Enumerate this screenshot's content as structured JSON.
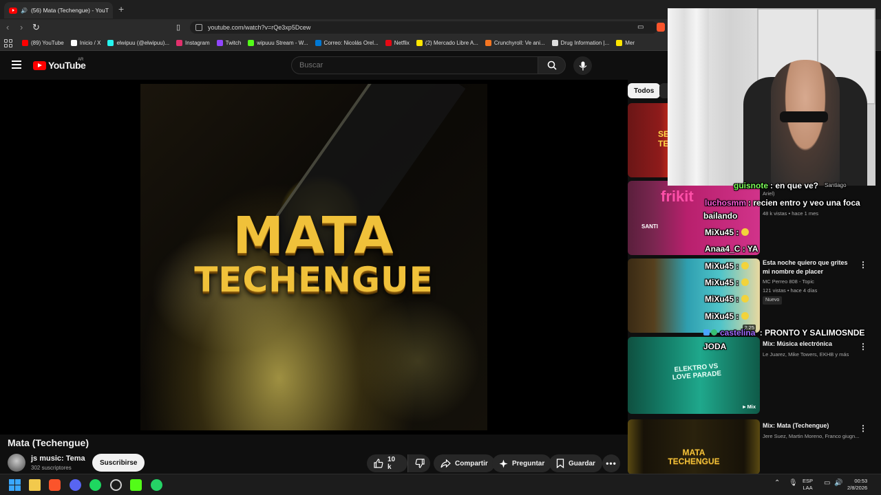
{
  "browser": {
    "tab_title": "(56) Mata (Techengue) - YouT",
    "url": "youtube.com/watch?v=rQe3xp5Dcew",
    "bookmarks": [
      {
        "label": "(89) YouTube",
        "color": "#ff0000"
      },
      {
        "label": "Inicio / X",
        "color": "#ffffff"
      },
      {
        "label": "elwipuu (@elwipuu)...",
        "color": "#25f4ee"
      },
      {
        "label": "Instagram",
        "color": "#e1306c"
      },
      {
        "label": "Twitch",
        "color": "#9146ff"
      },
      {
        "label": "wipuuu Stream - W...",
        "color": "#53fc18"
      },
      {
        "label": "Correo: Nicolás Orel...",
        "color": "#0078d4"
      },
      {
        "label": "Netflix",
        "color": "#e50914"
      },
      {
        "label": "(2) Mercado Libre A...",
        "color": "#ffe600"
      },
      {
        "label": "Crunchyroll: Ve ani...",
        "color": "#f47521"
      },
      {
        "label": "Drug Information |...",
        "color": "#ffffff"
      },
      {
        "label": "Mer",
        "color": "#ffe600"
      }
    ]
  },
  "youtube": {
    "logo_text": "YouTube",
    "country_code": "AR",
    "search_placeholder": "Buscar"
  },
  "video": {
    "art_line1": "MATA",
    "art_line2": "TECHENGUE",
    "title": "Mata (Techengue)",
    "channel": "js music: Tema",
    "subscribers": "302 suscriptores",
    "subscribe_label": "Suscribirse",
    "likes": "10 k",
    "share_label": "Compartir",
    "ask_label": "Preguntar",
    "save_label": "Guardar"
  },
  "sidebar": {
    "chip_all": "Todos",
    "recommendations": [
      {
        "title": "",
        "meta": [
          "48 k vistas • hace 1 mes"
        ]
      },
      {
        "title": "Esta noche quiero que grites mi nombre de placer",
        "meta": [
          "MC Perreo 808 - Topic",
          "121 vistas • hace 4 días"
        ],
        "badge": "Nuevo",
        "duration": "2:25"
      },
      {
        "title": "Mix: Música electrónica",
        "meta": [
          "Le Juarez, Mike Towers, EKHB y más"
        ],
        "thumb_text": "ELEKTRO VS LOVE PARADE",
        "tag": "Mix"
      },
      {
        "title": "Mix: Mata (Techengue)",
        "meta": [
          "Jere Suez, Martin Moreno, Franco giugn..."
        ],
        "thumb_text": "MATA TECHENGUE"
      }
    ]
  },
  "stream_overlay": {
    "thumb_text_red": "SE TE",
    "thumb_text_frikito": "frikit",
    "thumb_text_santi": "SANTI",
    "chat": [
      {
        "user": "guisnote",
        "message": ": en que ve?",
        "user_color": "#7cff5a"
      },
      {
        "user": "Santiago",
        "message": "",
        "user_color": "#cccccc"
      },
      {
        "user": "luchosmm",
        "message": ": recien entro y veo una foca",
        "user_color": "#ff5ad9"
      },
      {
        "user": "",
        "message": "bailando",
        "user_color": "#ffffff"
      },
      {
        "user": "MiXu45",
        "message": " :",
        "user_color": "#ffffff"
      },
      {
        "user": "Anaa4_C",
        "message": " : YA",
        "user_color": "#ffffff"
      },
      {
        "user": "MiXu45",
        "message": " :",
        "user_color": "#ffffff"
      },
      {
        "user": "MiXu45",
        "message": " :",
        "user_color": "#ffffff"
      },
      {
        "user": "MiXu45",
        "message": " :",
        "user_color": "#ffffff"
      },
      {
        "user": "MiXu45",
        "message": " :",
        "user_color": "#ffffff"
      },
      {
        "user": "castelina",
        "message": " : PRONTO Y SALIMOSNDE",
        "user_color": "#a06bff"
      },
      {
        "user": "",
        "message": "JODA",
        "user_color": "#ffffff"
      }
    ],
    "extra_meta": "Ariel)"
  },
  "taskbar": {
    "lang_line1": "ESP",
    "lang_line2": "LAA",
    "time": "00:53",
    "date": "2/8/2026"
  }
}
